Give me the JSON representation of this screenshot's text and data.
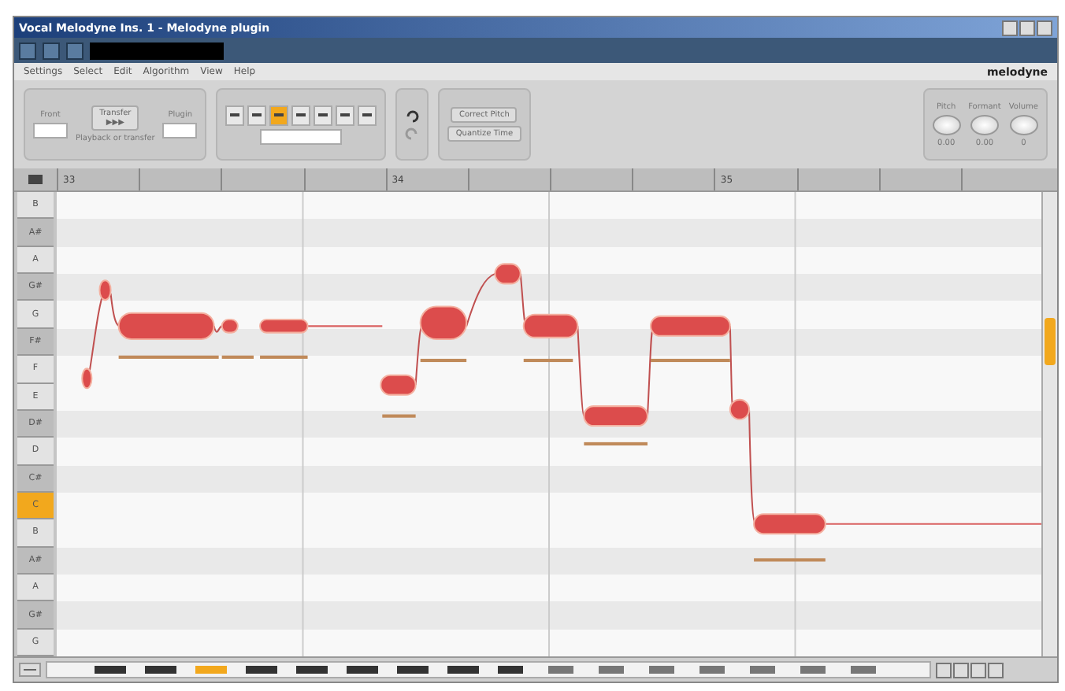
{
  "window": {
    "title": "Vocal Melodyne Ins. 1 - Melodyne plugin"
  },
  "menu": [
    {
      "label": "Settings"
    },
    {
      "label": "Select"
    },
    {
      "label": "Edit"
    },
    {
      "label": "Algorithm"
    },
    {
      "label": "View"
    },
    {
      "label": "Help"
    }
  ],
  "logo": "melodyne",
  "transfer": {
    "left_label": "Front",
    "button_label": "Transfer",
    "button_symbol": "▶▶▶",
    "right_label": "Plugin",
    "caption": "Playback or transfer"
  },
  "tools": [
    {
      "selected": false
    },
    {
      "selected": false
    },
    {
      "selected": true
    },
    {
      "selected": false
    },
    {
      "selected": false
    },
    {
      "selected": false
    },
    {
      "selected": false
    }
  ],
  "macros": [
    {
      "label": "Correct Pitch"
    },
    {
      "label": "Quantize Time"
    }
  ],
  "knobs": [
    {
      "label": "Pitch",
      "reading": "0.00"
    },
    {
      "label": "Formant",
      "reading": "0.00"
    },
    {
      "label": "Volume",
      "reading": "0"
    }
  ],
  "ruler": {
    "bars": [
      "33",
      "34",
      "35"
    ]
  },
  "pitch_rows": [
    {
      "note": "B",
      "selected": false
    },
    {
      "note": "A#",
      "selected": false
    },
    {
      "note": "A",
      "selected": false
    },
    {
      "note": "G#",
      "selected": false
    },
    {
      "note": "G",
      "selected": false
    },
    {
      "note": "F#",
      "selected": false
    },
    {
      "note": "F",
      "selected": false
    },
    {
      "note": "E",
      "selected": false
    },
    {
      "note": "D#",
      "selected": false
    },
    {
      "note": "D",
      "selected": false
    },
    {
      "note": "C#",
      "selected": false
    },
    {
      "note": "C",
      "selected": true
    },
    {
      "note": "B",
      "selected": false
    },
    {
      "note": "A#",
      "selected": false
    },
    {
      "note": "A",
      "selected": false
    },
    {
      "note": "G#",
      "selected": false
    },
    {
      "note": "G",
      "selected": false
    }
  ]
}
